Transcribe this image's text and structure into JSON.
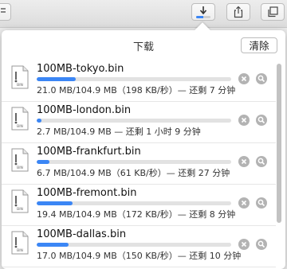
{
  "toolbar": {
    "buttons": [
      {
        "name": "downloads-button",
        "icon": "download-arrow-icon",
        "progress_fraction": 0.5
      },
      {
        "name": "share-button",
        "icon": "share-icon"
      },
      {
        "name": "tabs-overview-button",
        "icon": "tabs-icon"
      }
    ]
  },
  "downloads": {
    "title": "下载",
    "clear_label": "清除",
    "items": [
      {
        "filename": "100MB-tokyo.bin",
        "status": "21.0 MB/104.9 MB（198 KB/秒）— 还剩 7 分钟",
        "progress_fraction": 0.2
      },
      {
        "filename": "100MB-london.bin",
        "status": "2.7 MB/104.9 MB — 还剩 1 小时 9 分钟",
        "progress_fraction": 0.026
      },
      {
        "filename": "100MB-frankfurt.bin",
        "status": "6.7 MB/104.9 MB（61 KB/秒）— 还剩 27 分钟",
        "progress_fraction": 0.064
      },
      {
        "filename": "100MB-fremont.bin",
        "status": "19.4 MB/104.9 MB（172 KB/秒）— 还剩 8 分钟",
        "progress_fraction": 0.185
      },
      {
        "filename": "100MB-dallas.bin",
        "status": "17.0 MB/104.9 MB（150 KB/秒）— 还剩 10 分钟",
        "progress_fraction": 0.162
      }
    ]
  },
  "colors": {
    "progress_fill": "#3b86f5",
    "progress_track": "#e2e2e2",
    "action_button": "#b3b3b3"
  }
}
